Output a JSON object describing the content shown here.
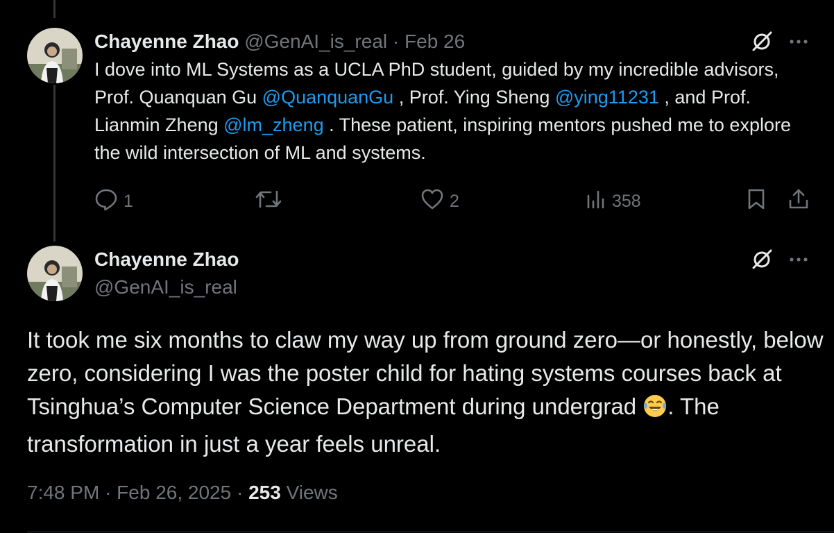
{
  "tweet1": {
    "author_name": "Chayenne Zhao",
    "handle": "@GenAI_is_real",
    "separator": "·",
    "date": "Feb 26",
    "text_parts": {
      "p1": "I dove into ML Systems as a UCLA PhD student, guided by my incredible advisors, Prof. Quanquan Gu ",
      "m1": "@QuanquanGu",
      "p2": " , Prof. Ying Sheng ",
      "m2": "@ying11231",
      "p3": " , and Prof. Lianmin Zheng ",
      "m3": "@lm_zheng",
      "p4": " . These patient, inspiring mentors pushed me to explore the wild intersection of ML and systems."
    },
    "actions": {
      "reply_count": "1",
      "retweet_count": "",
      "like_count": "2",
      "views_count": "358"
    }
  },
  "tweet2": {
    "author_name": "Chayenne Zhao",
    "handle": "@GenAI_is_real",
    "text_before_emoji": "It took me six months to claw my way up from ground zero—or honestly, below zero, considering I was the poster child for hating systems courses back at Tsinghua’s Computer Science Department during undergrad ",
    "text_after_emoji": ". The transformation in just a year feels unreal.",
    "time": "7:48 PM",
    "separator": "·",
    "date": "Feb 26, 2025",
    "views_count": "253",
    "views_label": "Views"
  },
  "icons": {
    "grok": "grok-icon",
    "more": "more-icon",
    "reply": "reply-icon",
    "retweet": "retweet-icon",
    "like": "heart-icon",
    "views": "views-icon",
    "bookmark": "bookmark-icon",
    "share": "share-icon",
    "emoji": "tears-of-joy-emoji"
  },
  "colors": {
    "background": "#000000",
    "text": "#e7e9ea",
    "muted": "#71767b",
    "link": "#1d9bf0"
  }
}
